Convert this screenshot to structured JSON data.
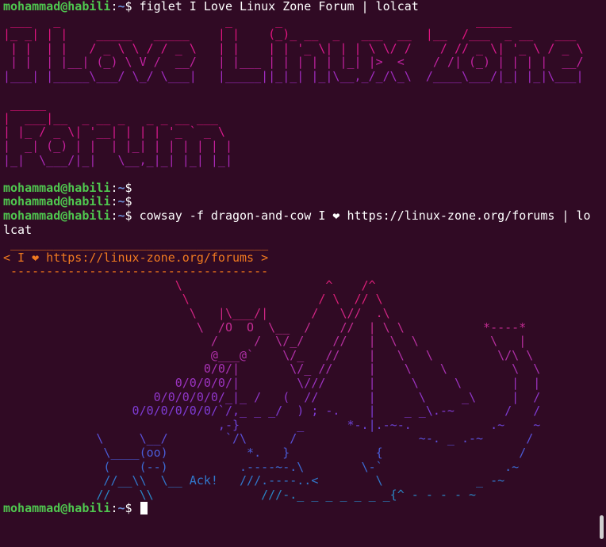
{
  "prompt": {
    "user": "mohammad@habili",
    "sep": ":",
    "path": "~",
    "dollar": "$ "
  },
  "commands": {
    "figlet": "figlet I Love Linux Zone Forum | lolcat",
    "cowsay_a": "cowsay -f dragon-and-cow I ❤ https://linux-zone.org/forums | lo",
    "cowsay_b": "lcat"
  },
  "colors": {
    "background": "#300a24",
    "prompt_user": "#4fc74f",
    "prompt_path": "#6c8fd6",
    "text": "#ffffff"
  },
  "figlet_block": [
    {
      "text": " ___   _                       _      _                           _____                      ",
      "color": "#e8127d"
    },
    {
      "text": "|_ _| | |    _____   _____    | |    (_)_ __  _   ___  __  |__  /___  _ __   ___ ",
      "color": "#e0147f"
    },
    {
      "text": " | |  | |   / _ \\ \\ / / _ \\   | |    | | '_ \\| | | \\ \\/ /    / // _ \\| '_ \\ / _ \\",
      "color": "#d81a8e"
    },
    {
      "text": " | |  | |__| (_) \\ V /  __/   | |___ | | | | | |_| |>  <    / /| (_) | | | |  __/",
      "color": "#c0229f"
    },
    {
      "text": "|___| |_____\\___/ \\_/ \\___|   |_____||_|_| |_|\\__,_/_/\\_\\  /____\\___/|_| |_|\\___|",
      "color": "#a02cc0"
    },
    {
      "text": "",
      "color": "#ffffff"
    },
    {
      "text": " _____                          ",
      "color": "#e8127d"
    },
    {
      "text": "|  ___|__  _ __ _   _ _ __ ___  ",
      "color": "#e0147f"
    },
    {
      "text": "| |_ / _ \\| '__| | | | '_ ` _ \\ ",
      "color": "#d81a8e"
    },
    {
      "text": "|  _| (_) | |  | |_| | | | | | |",
      "color": "#c4209a"
    },
    {
      "text": "|_|  \\___/|_|   \\__,_|_| |_| |_|",
      "color": "#a82ab6"
    },
    {
      "text": "",
      "color": "#ffffff"
    }
  ],
  "cowsay_block": [
    {
      "text": " ____________________________________",
      "color": "#e8701a"
    },
    {
      "text": "< I ❤ https://linux-zone.org/forums >",
      "color": "#f07a20"
    },
    {
      "text": " ------------------------------------",
      "color": "#e8701a"
    },
    {
      "text": "                        \\                    ^    /^",
      "color": "#d81f78"
    },
    {
      "text": "                         \\                  / \\  // \\",
      "color": "#d81f78"
    },
    {
      "text": "                          \\   |\\___/|      /   \\//  .\\",
      "color": "#cf2684"
    },
    {
      "text": "                           \\  /O  O  \\__  /    //  | \\ \\           *----*",
      "color": "#c22c92"
    },
    {
      "text": "                             /     /  \\/_/    //   |  \\  \\          \\   |",
      "color": "#b8309f"
    },
    {
      "text": "                             @___@`    \\/_   //    |   \\   \\         \\/\\ \\",
      "color": "#b030a8"
    },
    {
      "text": "                            0/0/|       \\/_ //     |    \\    \\         \\  \\",
      "color": "#a832b4"
    },
    {
      "text": "                        0/0/0/0/|        \\///      |     \\     \\       |  |",
      "color": "#9b33bf"
    },
    {
      "text": "                     0/0/0/0/0/_|_ /   (  //       |      \\     _\\     |  /",
      "color": "#8f36c8"
    },
    {
      "text": "                  0/0/0/0/0/0/`/,_ _ _/  ) ; -.    |    _ _\\.-~       /   /",
      "color": "#7e3bd3"
    },
    {
      "text": "                              ,-}        _      *-.|.-~-.           .~    ~",
      "color": "#6c44d8"
    },
    {
      "text": "             \\     \\__/        `/\\      /                 ~-. _ .-~      /",
      "color": "#5a50d8"
    },
    {
      "text": "              \\____(oo)           *.   }            {                   /",
      "color": "#4a5cd6"
    },
    {
      "text": "              (    (--)          .----~-.\\        \\-`                 .~",
      "color": "#3c6ad2"
    },
    {
      "text": "              //__\\\\  \\__ Ack!   ///.----..<        \\             _ -~",
      "color": "#3178cc"
    },
    {
      "text": "             //    \\\\               ///-._ _ _ _ _ _ _{^ - - - - ~",
      "color": "#2a86c4"
    }
  ]
}
